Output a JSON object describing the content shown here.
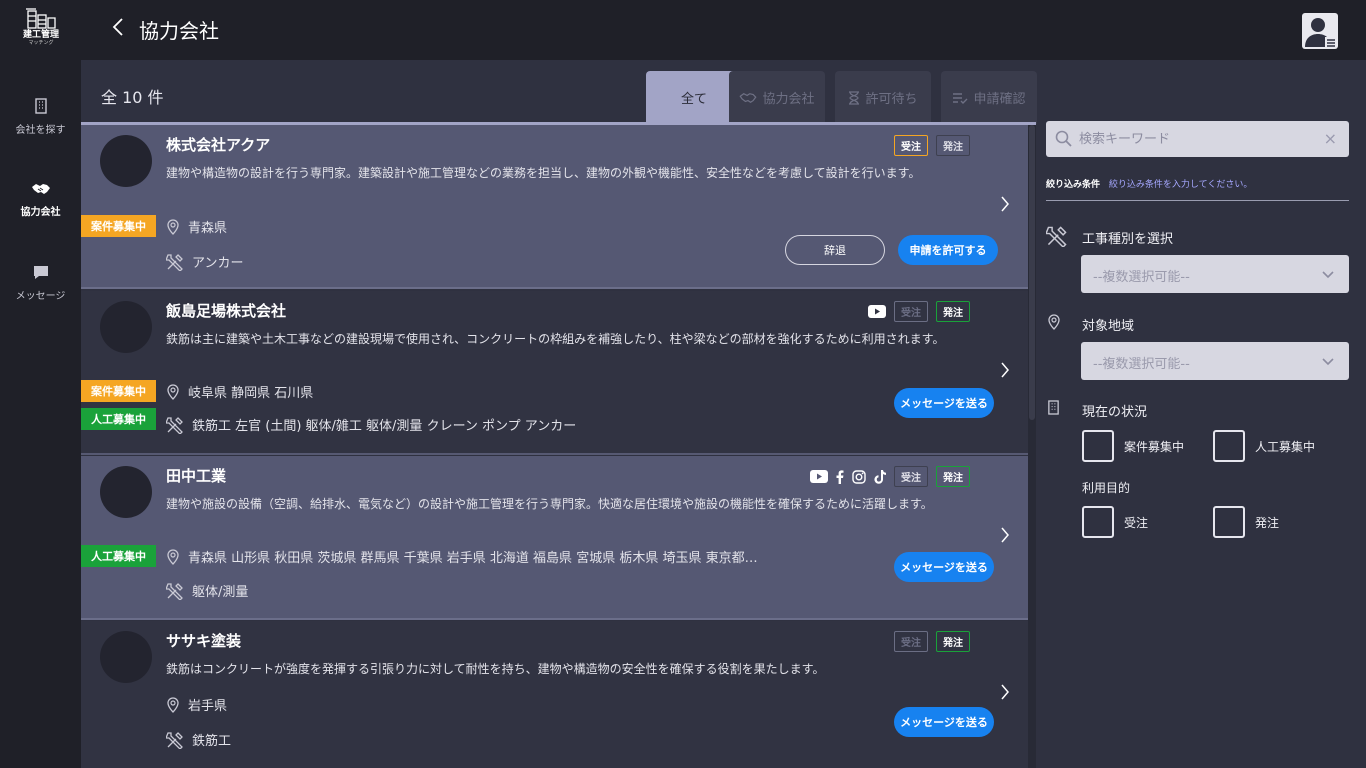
{
  "app": {
    "logo_text": "建工管理",
    "logo_sub": "マッチング"
  },
  "nav": {
    "items": [
      {
        "label": "会社を探す",
        "icon": "building-icon"
      },
      {
        "label": "協力会社",
        "icon": "handshake-icon"
      },
      {
        "label": "メッセージ",
        "icon": "chat-icon"
      }
    ]
  },
  "header": {
    "title": "協力会社"
  },
  "list": {
    "count_label": "全 10 件",
    "tabs": [
      {
        "label": "全て",
        "active": true,
        "icon": ""
      },
      {
        "label": "協力会社",
        "active": false,
        "icon": "handshake-icon"
      },
      {
        "label": "許可待ち",
        "active": false,
        "icon": "hourglass-icon"
      },
      {
        "label": "申請確認",
        "active": false,
        "icon": "list-check-icon"
      }
    ],
    "badge_juchu": "受注",
    "badge_hacchu": "発注",
    "status_recruiting_project": "案件募集中",
    "status_recruiting_workers": "人工募集中",
    "cards": [
      {
        "name": "株式会社アクア",
        "description": "建物や構造物の設計を行う専門家。建築設計や施工管理などの業務を担当し、建物の外観や機能性、安全性などを考慮して設計を行います。",
        "regions": "青森県",
        "trades": "アンカー",
        "decline_label": "辞退",
        "approve_label": "申請を許可する"
      },
      {
        "name": "飯島足場株式会社",
        "description": "鉄筋は主に建築や土木工事などの建設現場で使用され、コンクリートの枠組みを補強したり、柱や梁などの部材を強化するために利用されます。",
        "regions": "岐阜県 静岡県 石川県",
        "trades": "鉄筋工 左官 (土間) 躯体/雑工 躯体/測量 クレーン ポンプ アンカー",
        "message_label": "メッセージを送る"
      },
      {
        "name": "田中工業",
        "description": "建物や施設の設備（空調、給排水、電気など）の設計や施工管理を行う専門家。快適な居住環境や施設の機能性を確保するために活躍します。",
        "regions": "青森県 山形県 秋田県 茨城県 群馬県 千葉県 岩手県 北海道 福島県 宮城県 栃木県 埼玉県 東京都…",
        "trades": "躯体/測量",
        "message_label": "メッセージを送る"
      },
      {
        "name": "ササキ塗装",
        "description": "鉄筋はコンクリートが強度を発揮する引張り力に対して耐性を持ち、建物や構造物の安全性を確保する役割を果たします。",
        "regions": "岩手県",
        "trades": "鉄筋工",
        "message_label": "メッセージを送る"
      }
    ]
  },
  "filters": {
    "search_placeholder": "検索キーワード",
    "clear_icon": "×",
    "condition_label": "絞り込み条件",
    "condition_hint": "絞り込み条件を入力してください。",
    "trade_label": "工事種別を選択",
    "trade_placeholder": "--複数選択可能--",
    "region_label": "対象地域",
    "region_placeholder": "--複数選択可能--",
    "status_label": "現在の状況",
    "status_options": [
      "案件募集中",
      "人工募集中"
    ],
    "purpose_label": "利用目的",
    "purpose_options": [
      "受注",
      "発注"
    ]
  },
  "colors": {
    "accent_blue": "#1782f0",
    "orange": "#f5a623",
    "green": "#1aa23a",
    "tab_active": "#a2a4c6"
  }
}
